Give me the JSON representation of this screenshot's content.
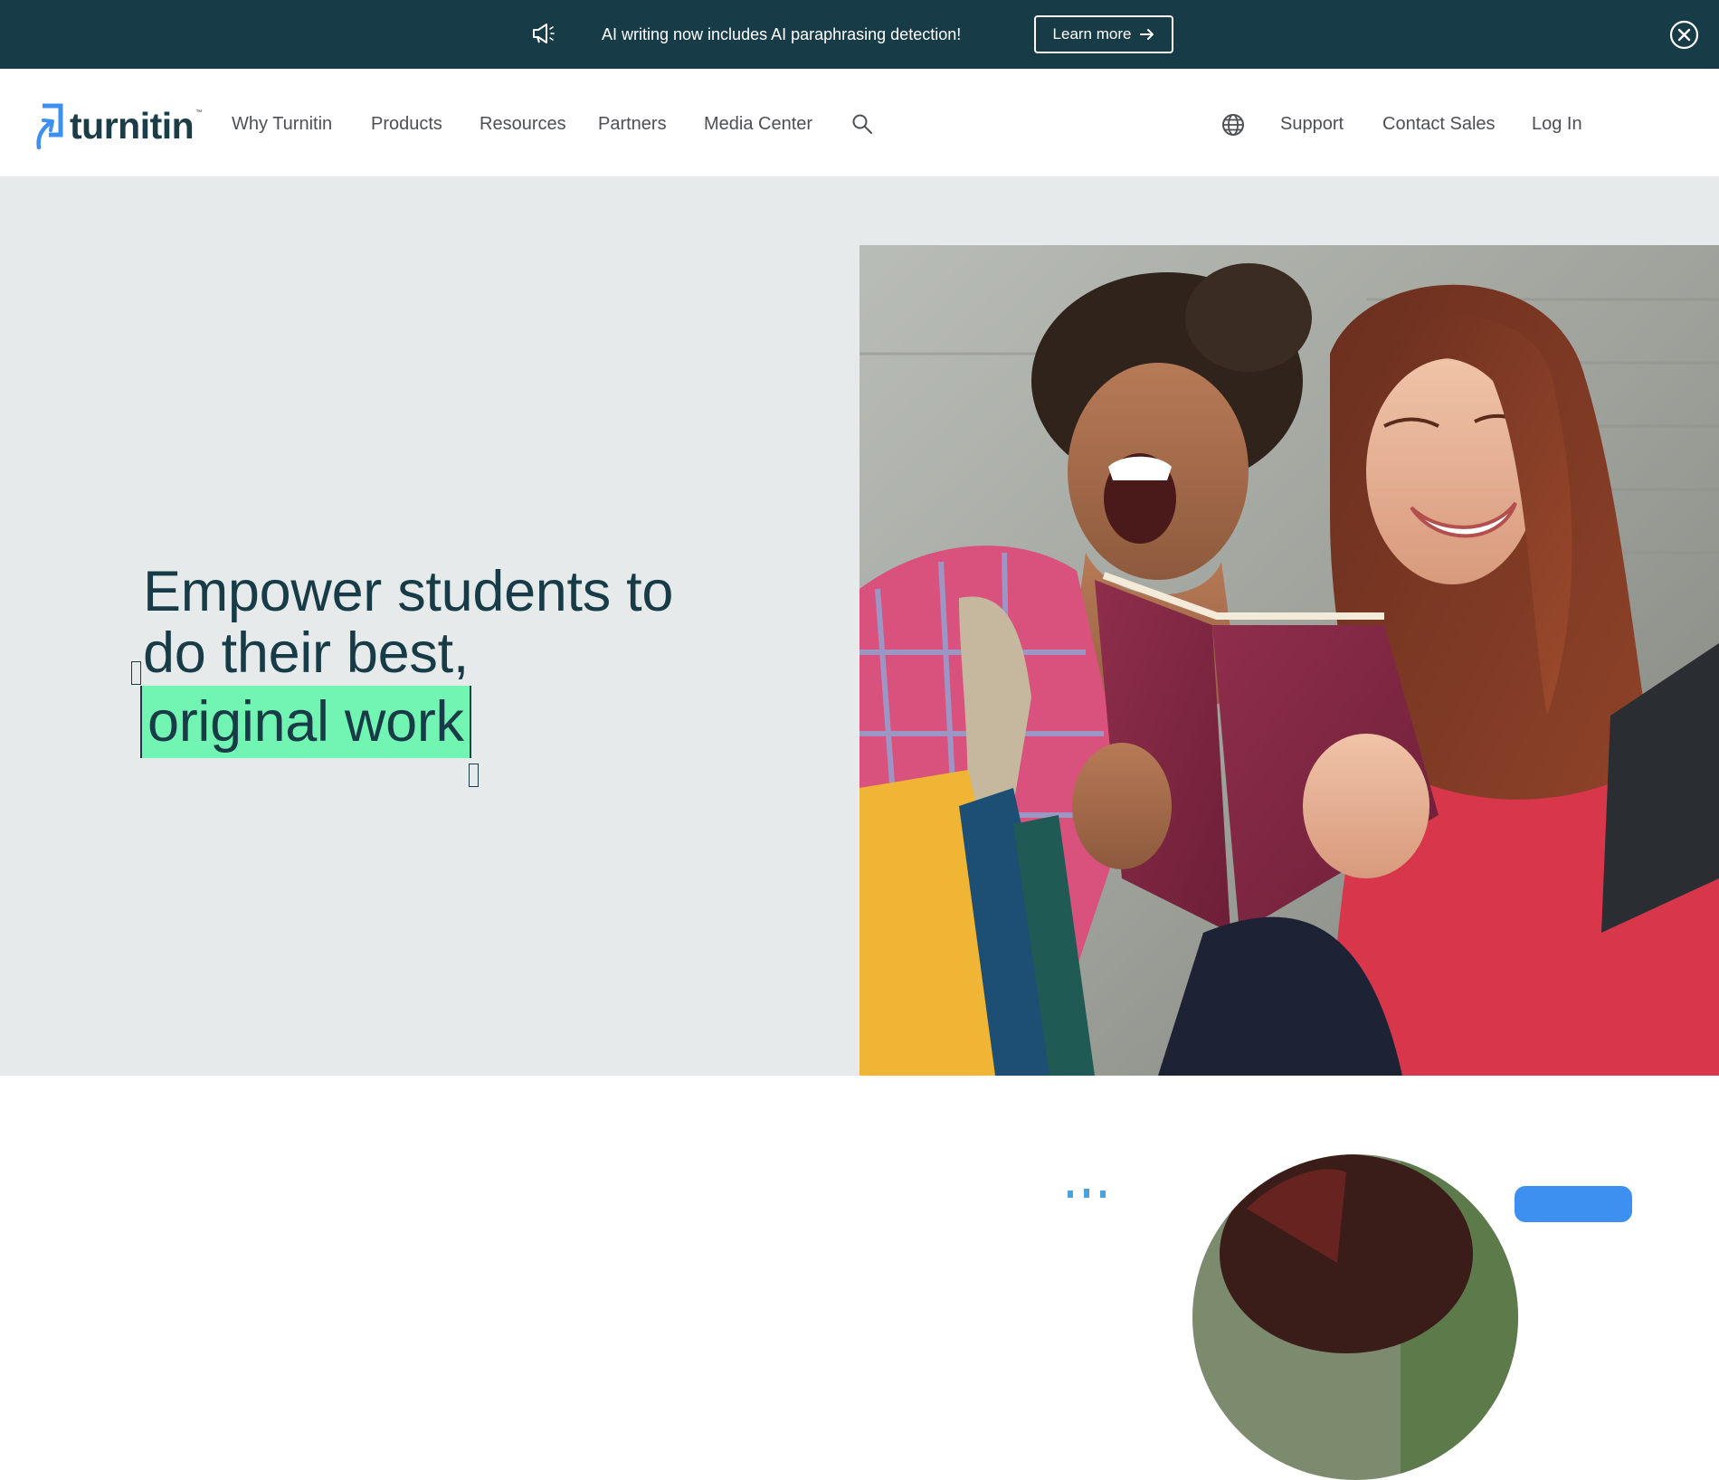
{
  "announcement": {
    "icon": "megaphone-icon",
    "message": "AI writing now includes AI paraphrasing detection!",
    "cta_label": "Learn more",
    "cta_icon": "arrow-right-icon",
    "close_icon": "close-circle-icon"
  },
  "header": {
    "logo_text": "turnitin",
    "logo_tm": "™",
    "nav": [
      {
        "label": "Why Turnitin"
      },
      {
        "label": "Products"
      },
      {
        "label": "Resources"
      },
      {
        "label": "Partners"
      },
      {
        "label": "Media Center"
      }
    ],
    "search_icon": "search-icon",
    "language_icon": "globe-icon",
    "utility": [
      {
        "label": "Support"
      },
      {
        "label": "Contact Sales"
      },
      {
        "label": "Log In"
      }
    ]
  },
  "hero": {
    "headline_line1": "Empower students to",
    "headline_line2": "do their best,",
    "headline_highlight": "original work",
    "image_alt": "Two smiling students reading a red book outdoors"
  },
  "colors": {
    "banner_bg": "#183c47",
    "hero_bg": "#e6eaeb",
    "highlight": "#72f5b2",
    "brand_blue": "#3e90f0",
    "text_dark": "#183c47",
    "nav_text": "#4d4f53"
  }
}
